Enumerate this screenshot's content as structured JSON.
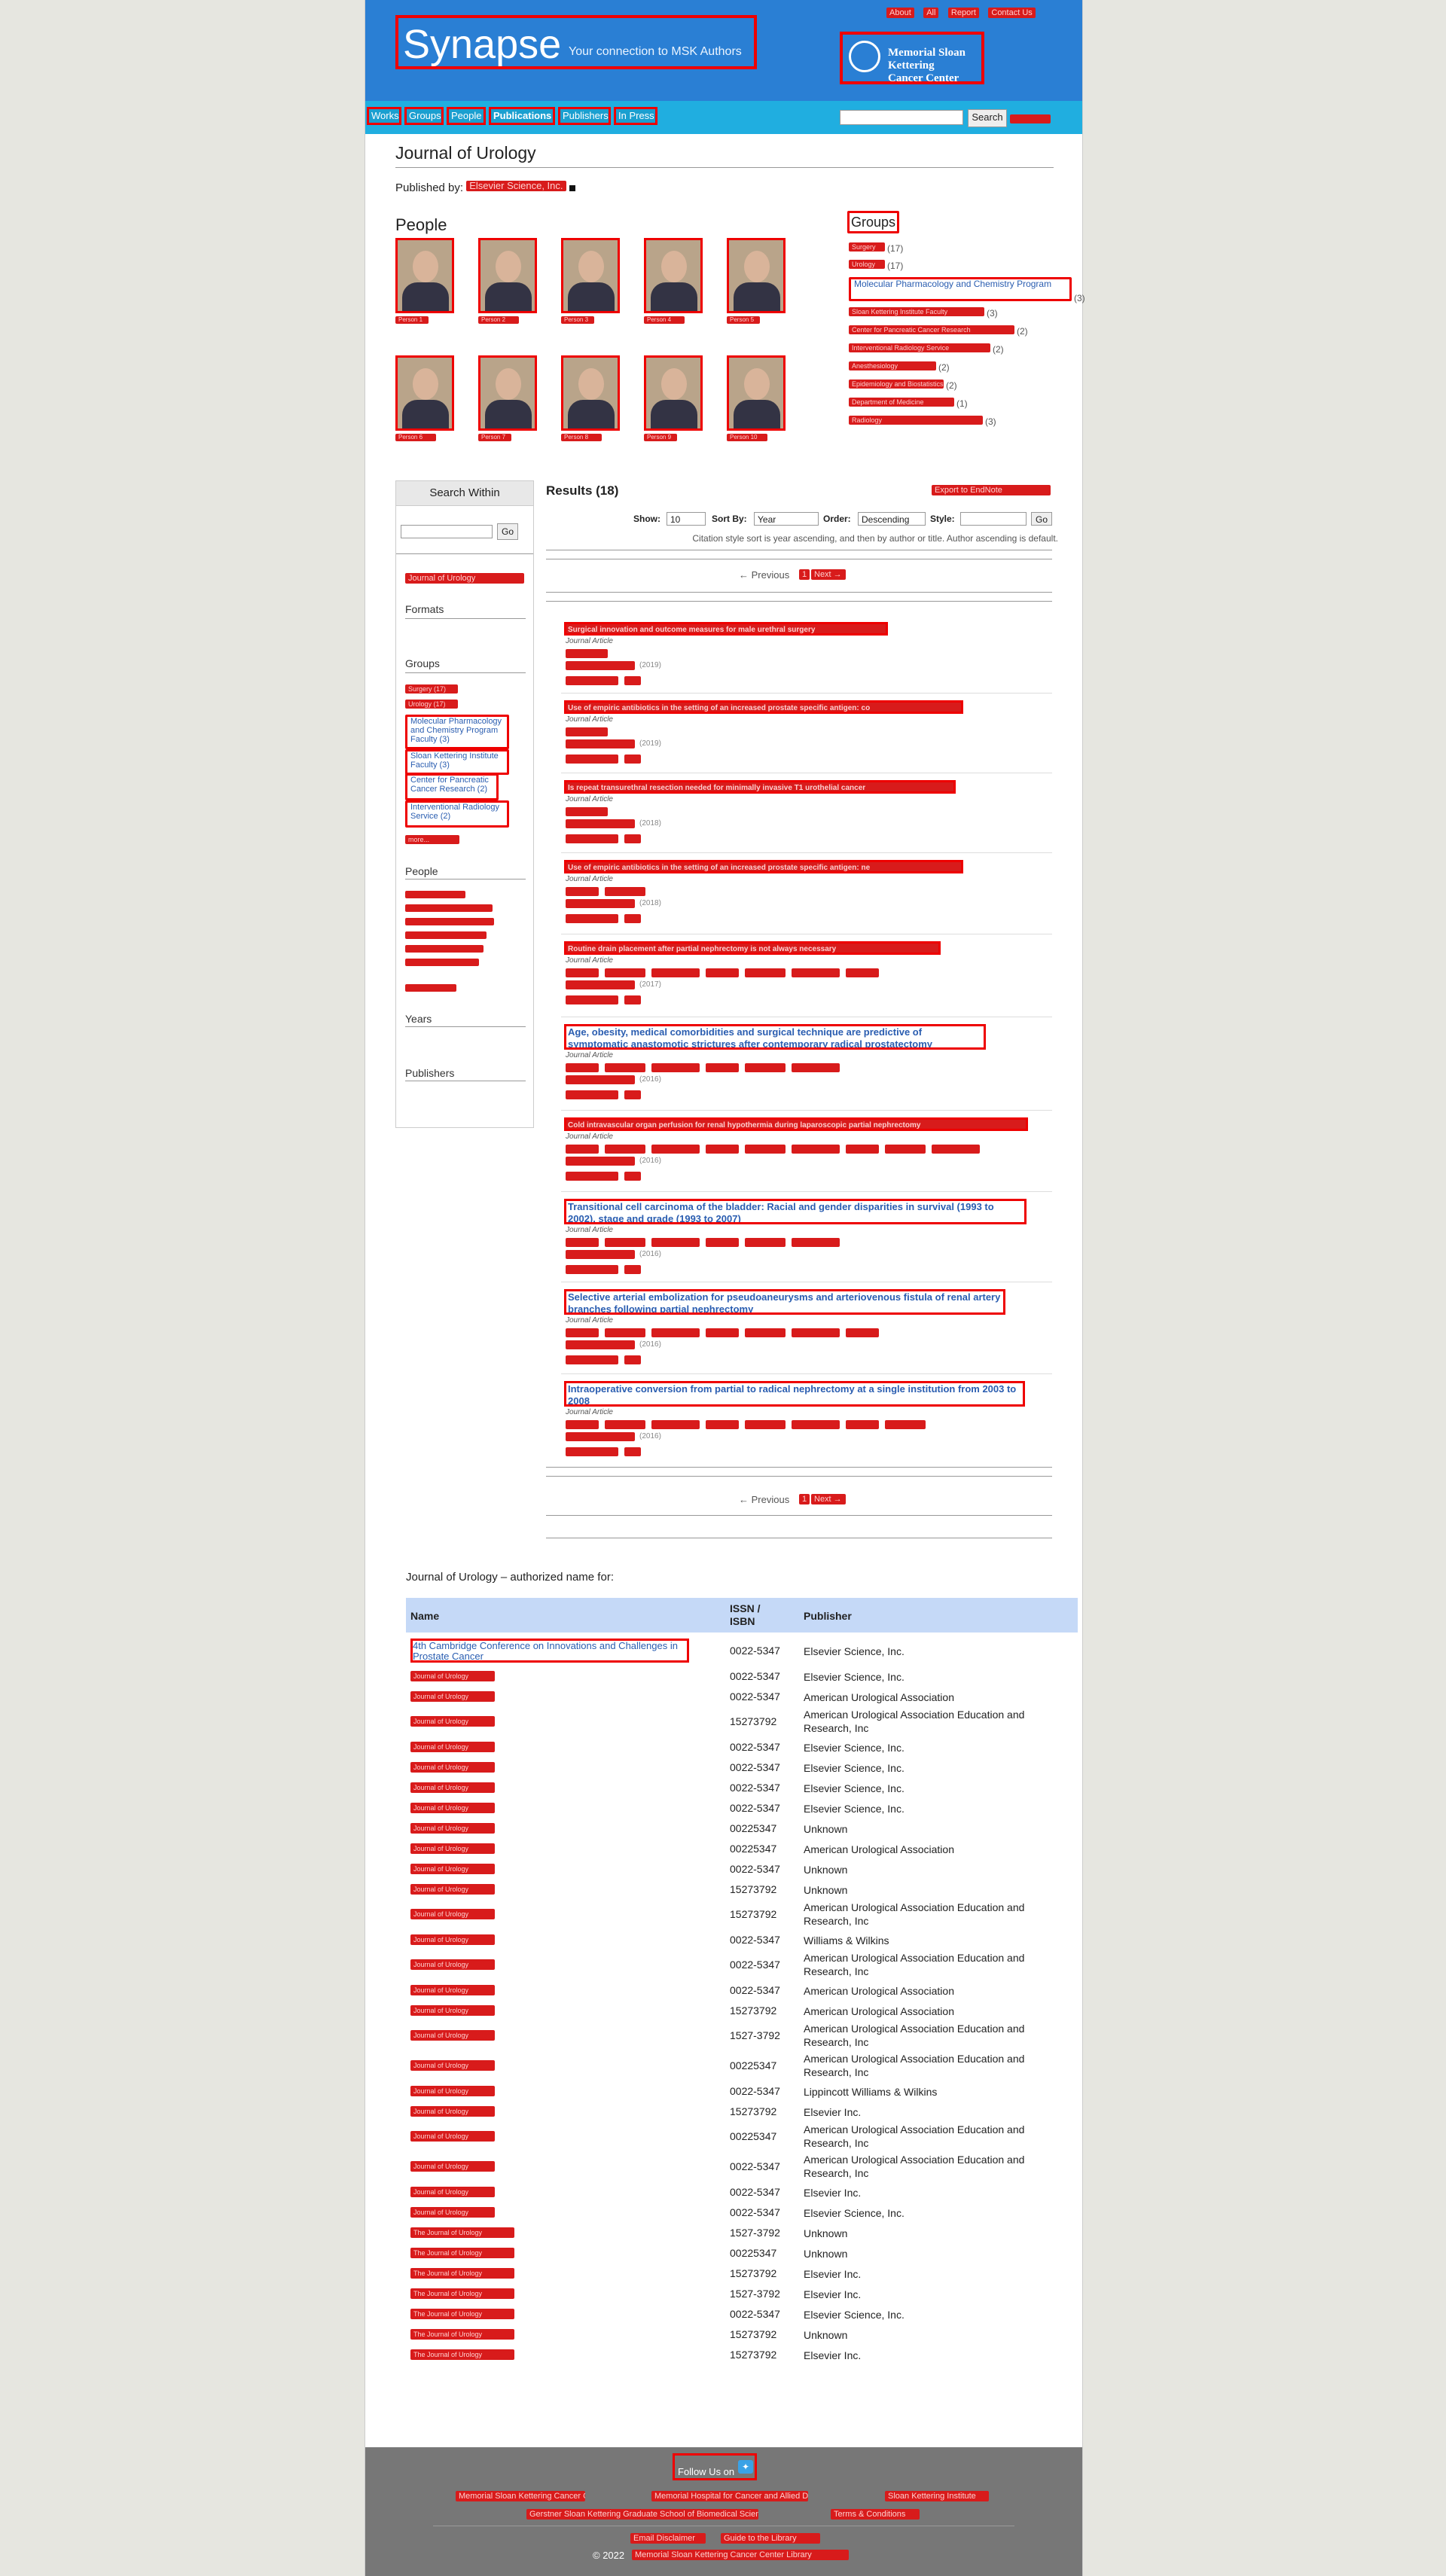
{
  "header": {
    "logo_main": "Synapse",
    "logo_tagline": "Your connection to MSK Authors",
    "top_links": [
      "About",
      "All",
      "Report",
      "Contact Us"
    ],
    "msk_logo_line1": "Memorial Sloan Kettering",
    "msk_logo_line2": "Cancer Center"
  },
  "nav": {
    "items": [
      "Works",
      "Groups",
      "People",
      "Publications",
      "Publishers",
      "In Press"
    ],
    "active": "Publications",
    "search_button": "Search",
    "search_value": ""
  },
  "journal": {
    "title": "Journal of Urology",
    "published_by_label": "Published by:",
    "publisher": "Elsevier Science, Inc."
  },
  "people": {
    "heading": "People",
    "items": [
      "Person 1",
      "Person 2",
      "Person 3",
      "Person 4",
      "Person 5",
      "Person 6",
      "Person 7",
      "Person 8",
      "Person 9",
      "Person 10"
    ]
  },
  "groups": {
    "heading": "Groups",
    "items": [
      {
        "label": "Surgery",
        "count": "(17)"
      },
      {
        "label": "Urology",
        "count": "(17)"
      },
      {
        "label": "Molecular Pharmacology and Chemistry Program",
        "count": "(3)"
      },
      {
        "label": "Sloan Kettering Institute Faculty",
        "count": "(3)"
      },
      {
        "label": "Center for Pancreatic Cancer Research",
        "count": "(2)"
      },
      {
        "label": "Interventional Radiology Service",
        "count": "(2)"
      },
      {
        "label": "Anesthesiology",
        "count": "(2)"
      },
      {
        "label": "Epidemiology and Biostatistics",
        "count": "(2)"
      },
      {
        "label": "Department of Medicine",
        "count": "(1)"
      },
      {
        "label": "Radiology",
        "count": "(3)"
      }
    ]
  },
  "sidebar": {
    "title": "Search Within",
    "go": "Go",
    "filter_chip": "Journal of Urology",
    "formats_h": "Formats",
    "groups_h": "Groups",
    "group_items": [
      "Surgery (17)",
      "Urology (17)",
      "Molecular Pharmacology and Chemistry Program Faculty (3)",
      "Sloan Kettering Institute Faculty (3)",
      "Center for Pancreatic Cancer Research (2)",
      "Interventional Radiology Service (2)",
      "more..."
    ],
    "people_h": "People",
    "years_h": "Years",
    "publishers_h": "Publishers"
  },
  "results": {
    "heading": "Results (18)",
    "export_label": "Export to EndNote",
    "show_label": "Show:",
    "show_value": "10",
    "sort_label": "Sort By:",
    "sort_value": "Year",
    "order_label": "Order:",
    "order_value": "Descending",
    "style_label": "Style:",
    "style_value": "",
    "go": "Go",
    "note": "Citation style sort is year ascending, and then by author or title. Author ascending is default.",
    "prev": "← Previous",
    "page": "1",
    "next": "Next →",
    "items": [
      {
        "title": "Surgical innovation and outcome measures for male urethral surgery",
        "type": "Journal Article",
        "year": "(2019)"
      },
      {
        "title": "Use of empiric antibiotics in the setting of an increased prostate specific antigen: co",
        "type": "Journal Article",
        "year": "(2019)"
      },
      {
        "title": "Is repeat transurethral resection needed for minimally invasive T1 urothelial cancer",
        "type": "Journal Article",
        "year": "(2018)"
      },
      {
        "title": "Use of empiric antibiotics in the setting of an increased prostate specific antigen: ne",
        "type": "Journal Article",
        "year": "(2018)"
      },
      {
        "title": "Routine drain placement after partial nephrectomy is not always necessary",
        "type": "Journal Article",
        "year": "(2017)"
      },
      {
        "title": "Age, obesity, medical comorbidities and surgical technique are predictive of symptomatic anastomotic strictures after contemporary radical prostatectomy",
        "type": "Journal Article",
        "year": "(2016)"
      },
      {
        "title": "Cold intravascular organ perfusion for renal hypothermia during laparoscopic partial nephrectomy",
        "type": "Journal Article",
        "year": "(2016)"
      },
      {
        "title": "Transitional cell carcinoma of the bladder: Racial and gender disparities in survival (1993 to 2002), stage and grade (1993 to 2007)",
        "type": "Journal Article",
        "year": "(2016)"
      },
      {
        "title": "Selective arterial embolization for pseudoaneurysms and arteriovenous fistula of renal artery branches following partial nephrectomy",
        "type": "Journal Article",
        "year": "(2016)"
      },
      {
        "title": "Intraoperative conversion from partial to radical nephrectomy at a single institution from 2003 to 2008",
        "type": "Journal Article",
        "year": "(2016)"
      }
    ]
  },
  "authorized": {
    "heading": "Journal of Urology – authorized name for:",
    "col_name": "Name",
    "col_issn": "ISSN / ISBN",
    "col_publisher": "Publisher",
    "rows": [
      {
        "name": "4th Cambridge Conference on Innovations and Challenges in Prostate Cancer",
        "issn": "0022-5347",
        "publisher": "Elsevier Science, Inc."
      },
      {
        "name": "Journal of Urology",
        "issn": "0022-5347",
        "publisher": "Elsevier Science, Inc."
      },
      {
        "name": "Journal of Urology",
        "issn": "0022-5347",
        "publisher": "American Urological Association"
      },
      {
        "name": "Journal of Urology",
        "issn": "15273792",
        "publisher": "American Urological Association Education and Research, Inc"
      },
      {
        "name": "Journal of Urology",
        "issn": "0022-5347",
        "publisher": "Elsevier Science, Inc."
      },
      {
        "name": "Journal of Urology",
        "issn": "0022-5347",
        "publisher": "Elsevier Science, Inc."
      },
      {
        "name": "Journal of Urology",
        "issn": "0022-5347",
        "publisher": "Elsevier Science, Inc."
      },
      {
        "name": "Journal of Urology",
        "issn": "0022-5347",
        "publisher": "Elsevier Science, Inc."
      },
      {
        "name": "Journal of Urology",
        "issn": "00225347",
        "publisher": "Unknown"
      },
      {
        "name": "Journal of Urology",
        "issn": "00225347",
        "publisher": "American Urological Association"
      },
      {
        "name": "Journal of Urology",
        "issn": "0022-5347",
        "publisher": "Unknown"
      },
      {
        "name": "Journal of Urology",
        "issn": "15273792",
        "publisher": "Unknown"
      },
      {
        "name": "Journal of Urology",
        "issn": "15273792",
        "publisher": "American Urological Association Education and Research, Inc"
      },
      {
        "name": "Journal of Urology",
        "issn": "0022-5347",
        "publisher": "Williams & Wilkins"
      },
      {
        "name": "Journal of Urology",
        "issn": "0022-5347",
        "publisher": "American Urological Association Education and Research, Inc"
      },
      {
        "name": "Journal of Urology",
        "issn": "0022-5347",
        "publisher": "American Urological Association"
      },
      {
        "name": "Journal of Urology",
        "issn": "15273792",
        "publisher": "American Urological Association"
      },
      {
        "name": "Journal of Urology",
        "issn": "1527-3792",
        "publisher": "American Urological Association Education and Research, Inc"
      },
      {
        "name": "Journal of Urology",
        "issn": "00225347",
        "publisher": "American Urological Association Education and Research, Inc"
      },
      {
        "name": "Journal of Urology",
        "issn": "0022-5347",
        "publisher": "Lippincott Williams & Wilkins"
      },
      {
        "name": "Journal of Urology",
        "issn": "15273792",
        "publisher": "Elsevier Inc."
      },
      {
        "name": "Journal of Urology",
        "issn": "00225347",
        "publisher": "American Urological Association Education and Research, Inc"
      },
      {
        "name": "Journal of Urology",
        "issn": "0022-5347",
        "publisher": "American Urological Association Education and Research, Inc"
      },
      {
        "name": "Journal of Urology",
        "issn": "0022-5347",
        "publisher": "Elsevier Inc."
      },
      {
        "name": "Journal of Urology",
        "issn": "0022-5347",
        "publisher": "Elsevier Science, Inc."
      },
      {
        "name": "The Journal of Urology",
        "issn": "1527-3792",
        "publisher": "Unknown"
      },
      {
        "name": "The Journal of Urology",
        "issn": "00225347",
        "publisher": "Unknown"
      },
      {
        "name": "The Journal of Urology",
        "issn": "15273792",
        "publisher": "Elsevier Inc."
      },
      {
        "name": "The Journal of Urology",
        "issn": "1527-3792",
        "publisher": "Elsevier Inc."
      },
      {
        "name": "The Journal of Urology",
        "issn": "0022-5347",
        "publisher": "Elsevier Science, Inc."
      },
      {
        "name": "The Journal of Urology",
        "issn": "15273792",
        "publisher": "Unknown"
      },
      {
        "name": "The Journal of Urology",
        "issn": "15273792",
        "publisher": "Elsevier Inc."
      }
    ]
  },
  "footer": {
    "follow": "Follow Us on",
    "links_row1": [
      "Memorial Sloan Kettering Cancer Center",
      "Memorial Hospital for Cancer and Allied Diseases",
      "Sloan Kettering Institute"
    ],
    "links_row2": [
      "Gerstner Sloan Kettering Graduate School of Biomedical Sciences",
      "Terms & Conditions"
    ],
    "links_row3": [
      "Email Disclaimer",
      "Guide to the Library"
    ],
    "copyright": "© 2022",
    "copyright_link": "Memorial Sloan Kettering Cancer Center Library"
  }
}
